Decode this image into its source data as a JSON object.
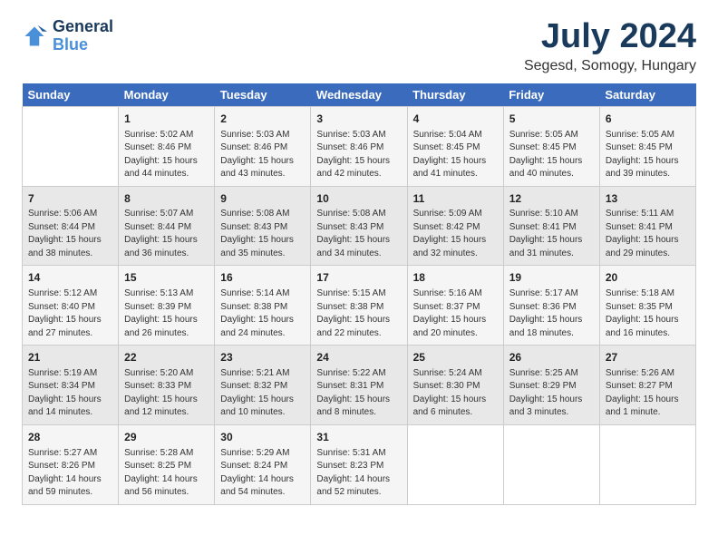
{
  "logo": {
    "line1": "General",
    "line2": "Blue"
  },
  "title": "July 2024",
  "location": "Segesd, Somogy, Hungary",
  "days_header": [
    "Sunday",
    "Monday",
    "Tuesday",
    "Wednesday",
    "Thursday",
    "Friday",
    "Saturday"
  ],
  "weeks": [
    [
      {
        "num": "",
        "info": ""
      },
      {
        "num": "1",
        "info": "Sunrise: 5:02 AM\nSunset: 8:46 PM\nDaylight: 15 hours\nand 44 minutes."
      },
      {
        "num": "2",
        "info": "Sunrise: 5:03 AM\nSunset: 8:46 PM\nDaylight: 15 hours\nand 43 minutes."
      },
      {
        "num": "3",
        "info": "Sunrise: 5:03 AM\nSunset: 8:46 PM\nDaylight: 15 hours\nand 42 minutes."
      },
      {
        "num": "4",
        "info": "Sunrise: 5:04 AM\nSunset: 8:45 PM\nDaylight: 15 hours\nand 41 minutes."
      },
      {
        "num": "5",
        "info": "Sunrise: 5:05 AM\nSunset: 8:45 PM\nDaylight: 15 hours\nand 40 minutes."
      },
      {
        "num": "6",
        "info": "Sunrise: 5:05 AM\nSunset: 8:45 PM\nDaylight: 15 hours\nand 39 minutes."
      }
    ],
    [
      {
        "num": "7",
        "info": "Sunrise: 5:06 AM\nSunset: 8:44 PM\nDaylight: 15 hours\nand 38 minutes."
      },
      {
        "num": "8",
        "info": "Sunrise: 5:07 AM\nSunset: 8:44 PM\nDaylight: 15 hours\nand 36 minutes."
      },
      {
        "num": "9",
        "info": "Sunrise: 5:08 AM\nSunset: 8:43 PM\nDaylight: 15 hours\nand 35 minutes."
      },
      {
        "num": "10",
        "info": "Sunrise: 5:08 AM\nSunset: 8:43 PM\nDaylight: 15 hours\nand 34 minutes."
      },
      {
        "num": "11",
        "info": "Sunrise: 5:09 AM\nSunset: 8:42 PM\nDaylight: 15 hours\nand 32 minutes."
      },
      {
        "num": "12",
        "info": "Sunrise: 5:10 AM\nSunset: 8:41 PM\nDaylight: 15 hours\nand 31 minutes."
      },
      {
        "num": "13",
        "info": "Sunrise: 5:11 AM\nSunset: 8:41 PM\nDaylight: 15 hours\nand 29 minutes."
      }
    ],
    [
      {
        "num": "14",
        "info": "Sunrise: 5:12 AM\nSunset: 8:40 PM\nDaylight: 15 hours\nand 27 minutes."
      },
      {
        "num": "15",
        "info": "Sunrise: 5:13 AM\nSunset: 8:39 PM\nDaylight: 15 hours\nand 26 minutes."
      },
      {
        "num": "16",
        "info": "Sunrise: 5:14 AM\nSunset: 8:38 PM\nDaylight: 15 hours\nand 24 minutes."
      },
      {
        "num": "17",
        "info": "Sunrise: 5:15 AM\nSunset: 8:38 PM\nDaylight: 15 hours\nand 22 minutes."
      },
      {
        "num": "18",
        "info": "Sunrise: 5:16 AM\nSunset: 8:37 PM\nDaylight: 15 hours\nand 20 minutes."
      },
      {
        "num": "19",
        "info": "Sunrise: 5:17 AM\nSunset: 8:36 PM\nDaylight: 15 hours\nand 18 minutes."
      },
      {
        "num": "20",
        "info": "Sunrise: 5:18 AM\nSunset: 8:35 PM\nDaylight: 15 hours\nand 16 minutes."
      }
    ],
    [
      {
        "num": "21",
        "info": "Sunrise: 5:19 AM\nSunset: 8:34 PM\nDaylight: 15 hours\nand 14 minutes."
      },
      {
        "num": "22",
        "info": "Sunrise: 5:20 AM\nSunset: 8:33 PM\nDaylight: 15 hours\nand 12 minutes."
      },
      {
        "num": "23",
        "info": "Sunrise: 5:21 AM\nSunset: 8:32 PM\nDaylight: 15 hours\nand 10 minutes."
      },
      {
        "num": "24",
        "info": "Sunrise: 5:22 AM\nSunset: 8:31 PM\nDaylight: 15 hours\nand 8 minutes."
      },
      {
        "num": "25",
        "info": "Sunrise: 5:24 AM\nSunset: 8:30 PM\nDaylight: 15 hours\nand 6 minutes."
      },
      {
        "num": "26",
        "info": "Sunrise: 5:25 AM\nSunset: 8:29 PM\nDaylight: 15 hours\nand 3 minutes."
      },
      {
        "num": "27",
        "info": "Sunrise: 5:26 AM\nSunset: 8:27 PM\nDaylight: 15 hours\nand 1 minute."
      }
    ],
    [
      {
        "num": "28",
        "info": "Sunrise: 5:27 AM\nSunset: 8:26 PM\nDaylight: 14 hours\nand 59 minutes."
      },
      {
        "num": "29",
        "info": "Sunrise: 5:28 AM\nSunset: 8:25 PM\nDaylight: 14 hours\nand 56 minutes."
      },
      {
        "num": "30",
        "info": "Sunrise: 5:29 AM\nSunset: 8:24 PM\nDaylight: 14 hours\nand 54 minutes."
      },
      {
        "num": "31",
        "info": "Sunrise: 5:31 AM\nSunset: 8:23 PM\nDaylight: 14 hours\nand 52 minutes."
      },
      {
        "num": "",
        "info": ""
      },
      {
        "num": "",
        "info": ""
      },
      {
        "num": "",
        "info": ""
      }
    ]
  ]
}
